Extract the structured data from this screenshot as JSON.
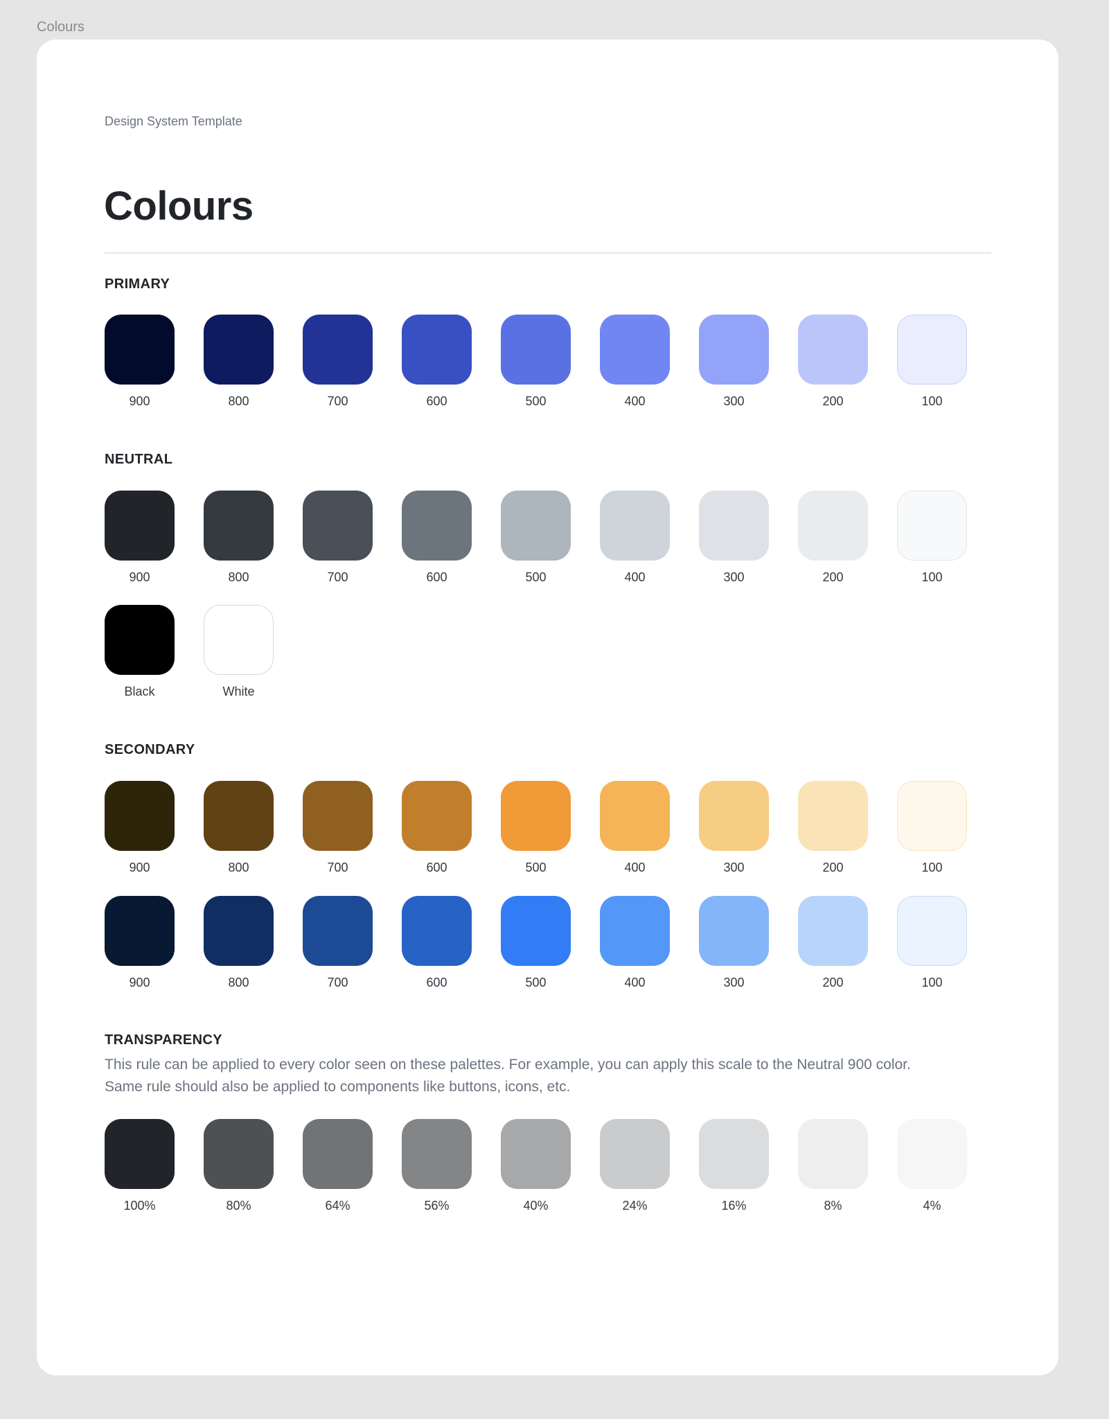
{
  "frame_label": "Colours",
  "header": {
    "eyebrow": "Design System Template",
    "title": "Colours"
  },
  "sections": {
    "primary": {
      "title": "PRIMARY",
      "rows": [
        [
          {
            "label": "900",
            "color": "#030b2d"
          },
          {
            "label": "800",
            "color": "#0e1b5e"
          },
          {
            "label": "700",
            "color": "#213395"
          },
          {
            "label": "600",
            "color": "#394fc4"
          },
          {
            "label": "500",
            "color": "#5a71e4"
          },
          {
            "label": "400",
            "color": "#7186f3"
          },
          {
            "label": "300",
            "color": "#93a3f7"
          },
          {
            "label": "200",
            "color": "#bcc5fa"
          },
          {
            "label": "100",
            "color": "#eaedfd",
            "border": "#c9d1f9"
          }
        ]
      ]
    },
    "neutral": {
      "title": "NEUTRAL",
      "rows": [
        [
          {
            "label": "900",
            "color": "#212529"
          },
          {
            "label": "800",
            "color": "#343a40"
          },
          {
            "label": "700",
            "color": "#495057"
          },
          {
            "label": "600",
            "color": "#6c757d"
          },
          {
            "label": "500",
            "color": "#adb5bd"
          },
          {
            "label": "400",
            "color": "#ced4da"
          },
          {
            "label": "300",
            "color": "#dee2e6"
          },
          {
            "label": "200",
            "color": "#e9ecef"
          },
          {
            "label": "100",
            "color": "#f8f9fa",
            "border": "#e3e6ea"
          }
        ],
        [
          {
            "label": "Black",
            "color": "#000000"
          },
          {
            "label": "White",
            "color": "#ffffff",
            "border": "#d6d9dd"
          }
        ]
      ]
    },
    "secondary": {
      "title": "SECONDARY",
      "rows": [
        [
          {
            "label": "900",
            "color": "#2e2409"
          },
          {
            "label": "800",
            "color": "#604214"
          },
          {
            "label": "700",
            "color": "#8f6020"
          },
          {
            "label": "600",
            "color": "#c17f2c"
          },
          {
            "label": "500",
            "color": "#f09a38"
          },
          {
            "label": "400",
            "color": "#f4b457"
          },
          {
            "label": "300",
            "color": "#f7cd84"
          },
          {
            "label": "200",
            "color": "#fae3b6"
          },
          {
            "label": "100",
            "color": "#fef7ec",
            "border": "#fbe3c2"
          }
        ],
        [
          {
            "label": "900",
            "color": "#081a33"
          },
          {
            "label": "800",
            "color": "#102e62"
          },
          {
            "label": "700",
            "color": "#1c4a95"
          },
          {
            "label": "600",
            "color": "#2762c5"
          },
          {
            "label": "500",
            "color": "#327cf5"
          },
          {
            "label": "400",
            "color": "#5397f7"
          },
          {
            "label": "300",
            "color": "#84b5f8"
          },
          {
            "label": "200",
            "color": "#b7d4fb"
          },
          {
            "label": "100",
            "color": "#ebf3fe",
            "border": "#c8dcfa"
          }
        ]
      ]
    },
    "transparency": {
      "title": "TRANSPARENCY",
      "description_line1": "This rule can be applied to every color seen on these palettes. For example, you can apply this scale to the Neutral 900 color.",
      "description_line2": "Same rule should also be applied to components like buttons, icons, etc.",
      "base_color": "#212529",
      "rows": [
        [
          {
            "label": "100%",
            "opacity": 1.0
          },
          {
            "label": "80%",
            "opacity": 0.8
          },
          {
            "label": "64%",
            "opacity": 0.64
          },
          {
            "label": "56%",
            "opacity": 0.56
          },
          {
            "label": "40%",
            "opacity": 0.4
          },
          {
            "label": "24%",
            "opacity": 0.24
          },
          {
            "label": "16%",
            "opacity": 0.16
          },
          {
            "label": "8%",
            "opacity": 0.08
          },
          {
            "label": "4%",
            "opacity": 0.04
          }
        ]
      ]
    }
  }
}
